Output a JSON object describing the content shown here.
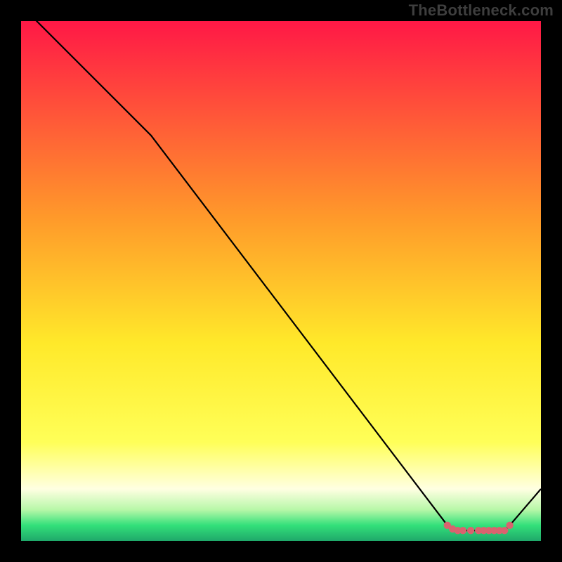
{
  "attribution": "TheBottleneck.com",
  "colors": {
    "frame": "#000000",
    "attribution_text": "#3e3e3e",
    "curve": "#000000",
    "marker_fill": "#d9636f",
    "gradient_top": "#ff1846",
    "gradient_mid_upper": "#ff9a2a",
    "gradient_mid": "#ffe92a",
    "gradient_low_bright": "#ffff58",
    "gradient_low_pale": "#ffffe2",
    "gradient_green_light": "#b7f7a8",
    "gradient_green": "#33e07a",
    "gradient_green_dark": "#1fa86a"
  },
  "chart_data": {
    "type": "line",
    "title": "",
    "xlabel": "",
    "ylabel": "",
    "xlim": [
      0,
      100
    ],
    "ylim": [
      0,
      100
    ],
    "legend_position": "none",
    "grid": false,
    "curve": [
      {
        "x": 0,
        "y": 103
      },
      {
        "x": 25,
        "y": 78
      },
      {
        "x": 82,
        "y": 3
      },
      {
        "x": 84,
        "y": 2
      },
      {
        "x": 93,
        "y": 2
      },
      {
        "x": 94,
        "y": 3
      },
      {
        "x": 100,
        "y": 10
      }
    ],
    "markers": [
      {
        "x": 82,
        "y": 3
      },
      {
        "x": 83,
        "y": 2.3
      },
      {
        "x": 84,
        "y": 2
      },
      {
        "x": 85,
        "y": 2
      },
      {
        "x": 86.5,
        "y": 2
      },
      {
        "x": 88,
        "y": 2
      },
      {
        "x": 89,
        "y": 2
      },
      {
        "x": 90,
        "y": 2
      },
      {
        "x": 91,
        "y": 2
      },
      {
        "x": 92,
        "y": 2
      },
      {
        "x": 93,
        "y": 2
      },
      {
        "x": 94,
        "y": 3
      }
    ]
  }
}
